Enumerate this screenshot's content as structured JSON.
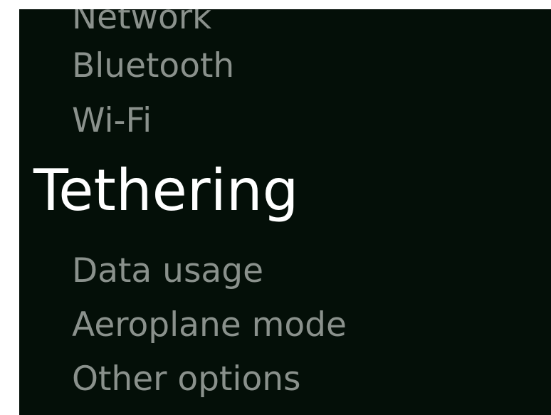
{
  "menu": {
    "items": [
      {
        "label": "Network"
      },
      {
        "label": "Bluetooth"
      },
      {
        "label": "Wi-Fi"
      },
      {
        "label": "Tethering",
        "selected": true
      },
      {
        "label": "Data usage"
      },
      {
        "label": "Aeroplane mode"
      },
      {
        "label": "Other options"
      }
    ]
  },
  "colors": {
    "background": "#040f08",
    "item_text": "#8a918c",
    "selected_text": "#ffffff"
  }
}
